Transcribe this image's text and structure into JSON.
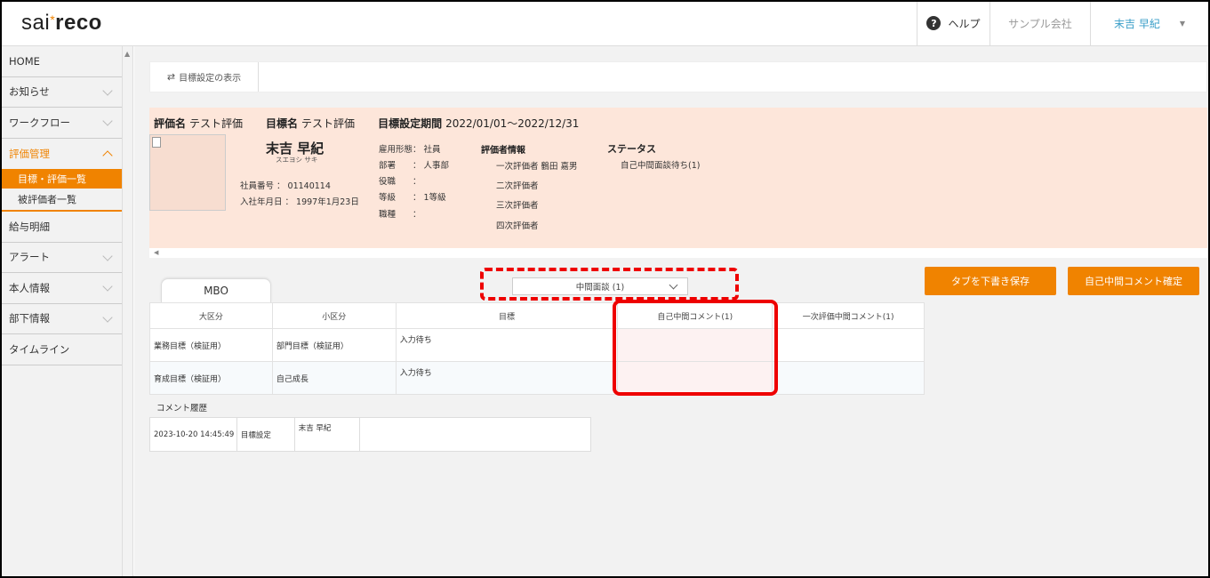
{
  "header": {
    "logo_left": "sai",
    "logo_star": "*",
    "logo_right": "reco",
    "help_label": "ヘルプ",
    "company": "サンプル会社",
    "user": "末吉 早紀"
  },
  "sidebar": {
    "items": [
      {
        "label": "HOME"
      },
      {
        "label": "お知らせ"
      },
      {
        "label": "ワークフロー"
      },
      {
        "label": "評価管理"
      },
      {
        "label": "給与明細"
      },
      {
        "label": "アラート"
      },
      {
        "label": "本人情報"
      },
      {
        "label": "部下情報"
      },
      {
        "label": "タイムライン"
      }
    ],
    "sub_items": [
      {
        "label": "目標・評価一覧"
      },
      {
        "label": "被評価者一覧"
      }
    ]
  },
  "toolbar": {
    "toggle_label": "目標設定の表示"
  },
  "info": {
    "eval_name_label": "評価名",
    "eval_name": "テスト評価",
    "goal_name_label": "目標名",
    "goal_name": "テスト評価",
    "period_label": "目標設定期間",
    "period": "2022/01/01～2022/12/31",
    "name": "末吉 早紀",
    "kana": "スエヨシ サキ",
    "emp_no": "社員番号 ： 01140114",
    "hire_date": "入社年月日 ： 1997年1月23日",
    "details": [
      {
        "key": "雇用形態",
        "value": "： 社員"
      },
      {
        "key": "部署",
        "value": "： 人事部"
      },
      {
        "key": "役職",
        "value": "："
      },
      {
        "key": "等級",
        "value": "： 1等級"
      },
      {
        "key": "職種",
        "value": "："
      }
    ],
    "evaluator_title": "評価者情報",
    "evaluators": [
      "一次評価者 鶴田 嘉男",
      "二次評価者",
      "三次評価者",
      "四次評価者"
    ],
    "status_title": "ステータス",
    "status": "自己中間面談待ち(1)"
  },
  "tab": {
    "label": "MBO"
  },
  "phase_select": {
    "value": "中間面談 (1)"
  },
  "buttons": {
    "save": "タブを下書き保存",
    "confirm": "自己中間コメント確定"
  },
  "goal_table": {
    "headers": [
      "大区分",
      "小区分",
      "目標",
      "自己中間コメント(1)",
      "一次評価中間コメント(1)"
    ],
    "rows": [
      {
        "major": "業務目標（検証用）",
        "minor": "部門目標（検証用）",
        "goal": "入力待ち"
      },
      {
        "major": "育成目標（検証用）",
        "minor": "自己成長",
        "goal": "入力待ち"
      }
    ]
  },
  "history": {
    "title": "コメント履歴",
    "rows": [
      {
        "datetime": "2023-10-20 14:45:49",
        "type": "目標設定",
        "author": "末吉 早紀",
        "comment": ""
      }
    ]
  }
}
